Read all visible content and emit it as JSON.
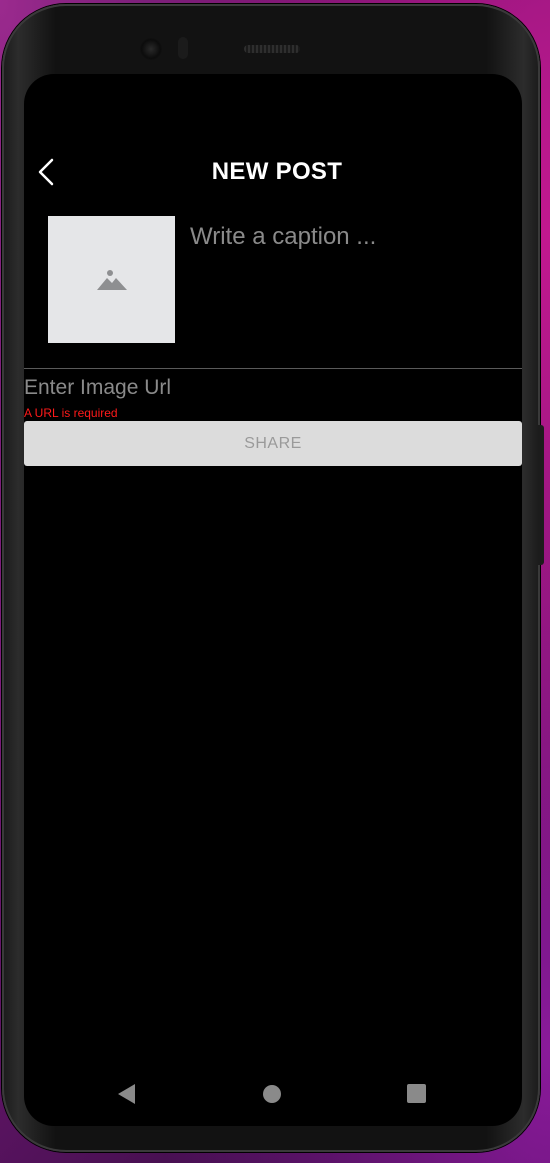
{
  "header": {
    "back_icon": "chevron-left-icon",
    "title": "NEW POST"
  },
  "post": {
    "thumbnail_icon": "image-placeholder-icon",
    "caption_placeholder": "Write a caption ...",
    "caption_value": "",
    "url_placeholder": "Enter Image Url",
    "url_value": "",
    "url_error": "A URL is required",
    "share_label": "SHARE"
  },
  "navbar": {
    "back_icon": "triangle-back-icon",
    "home_icon": "circle-home-icon",
    "recents_icon": "square-recents-icon"
  },
  "colors": {
    "screen_background": "#000000",
    "title_text": "#ffffff",
    "error_text": "#ff1a1a",
    "share_button_bg": "#dcdcdc",
    "share_button_text": "#9a9a9a",
    "placeholder_text": "#8a8a8a",
    "thumbnail_bg": "#e5e6e8"
  }
}
